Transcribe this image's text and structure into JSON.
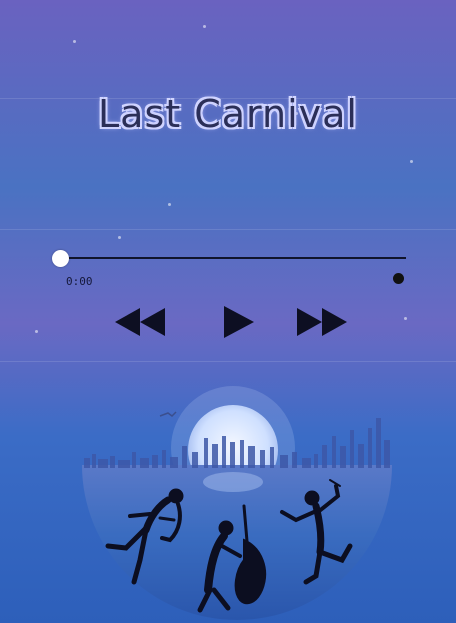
{
  "player": {
    "title": "Last Carnival",
    "current_time": "0:00",
    "progress": 0.0
  },
  "controls": {
    "rewind_icon": "rewind-icon",
    "play_icon": "play-icon",
    "fastforward_icon": "fast-forward-icon"
  },
  "colors": {
    "background_top": "#6a62c0",
    "background_mid": "#4a72c2",
    "background_bottom": "#2d5fba",
    "title_fill": "#2b2f58",
    "title_glow": "#d7dbff",
    "track": "#10142b",
    "thumb": "#ffffff",
    "moon": "#cfe0ff"
  },
  "artwork": {
    "subject": "musicians-silhouette-album-art"
  }
}
